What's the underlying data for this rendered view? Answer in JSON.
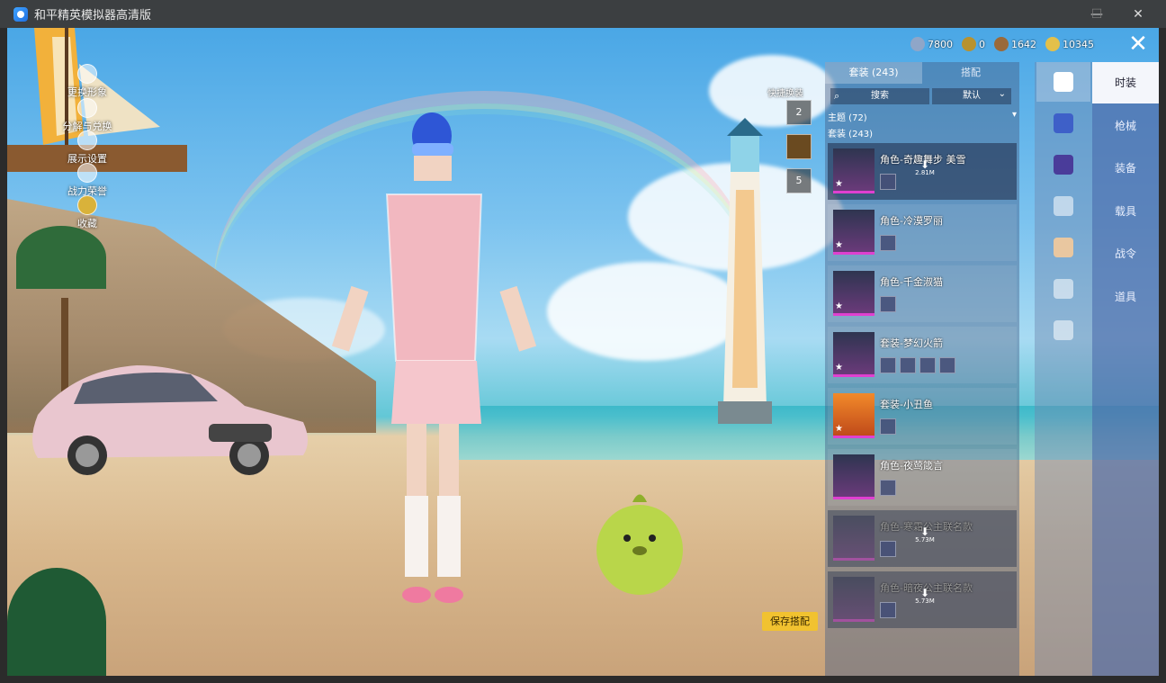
{
  "window": {
    "title": "和平精英模拟器高清版",
    "minimize": "—",
    "maximize": "☐",
    "close": "✕"
  },
  "left_menu": [
    {
      "label": "更换形象",
      "icon": "person-icon"
    },
    {
      "label": "分解与兑换",
      "icon": "exchange-icon"
    },
    {
      "label": "展示设置",
      "icon": "eye-icon"
    },
    {
      "label": "战力荣誉",
      "icon": "flame-icon"
    },
    {
      "label": "收藏",
      "icon": "trophy-icon"
    }
  ],
  "currencies": [
    {
      "value": "7800",
      "color": "#8fa6c8"
    },
    {
      "value": "0",
      "color": "#b8922e"
    },
    {
      "value": "1642",
      "color": "#9a6a3a"
    },
    {
      "value": "10345",
      "color": "#e3c04a"
    }
  ],
  "quick_change": {
    "label": "快捷换装",
    "slots": [
      "2",
      "",
      "5"
    ]
  },
  "save_button": "保存搭配",
  "panel": {
    "tabs": [
      "套装 (243)",
      "搭配"
    ],
    "search_placeholder": "搜索",
    "sort": "默认",
    "theme_filter": "主题 (72)",
    "set_count": "套装 (243)",
    "items": [
      {
        "name": "角色-奇趣舞步 美雪",
        "download": "2.81M",
        "minis": 1
      },
      {
        "name": "角色-冷漠罗丽",
        "download": "",
        "minis": 1
      },
      {
        "name": "角色-千金淑猫",
        "download": "",
        "minis": 1
      },
      {
        "name": "套装-梦幻火箭",
        "download": "",
        "minis": 4
      },
      {
        "name": "套装-小丑鱼",
        "download": "",
        "minis": 1
      },
      {
        "name": "角色-夜莺箴言",
        "download": "",
        "minis": 1
      },
      {
        "name": "角色-寒霜公主联名款",
        "download": "5.73M",
        "minis": 1
      },
      {
        "name": "角色-暗夜公主联名款",
        "download": "5.73M",
        "minis": 1
      }
    ]
  },
  "category_icons": [
    "hanger-icon",
    "helmet-hair-icon",
    "bag-icon",
    "mask-icon",
    "top-icon",
    "pants-icon",
    "shoes-icon"
  ],
  "right_tabs": [
    "时装",
    "枪械",
    "装备",
    "载具",
    "战令",
    "道具"
  ]
}
